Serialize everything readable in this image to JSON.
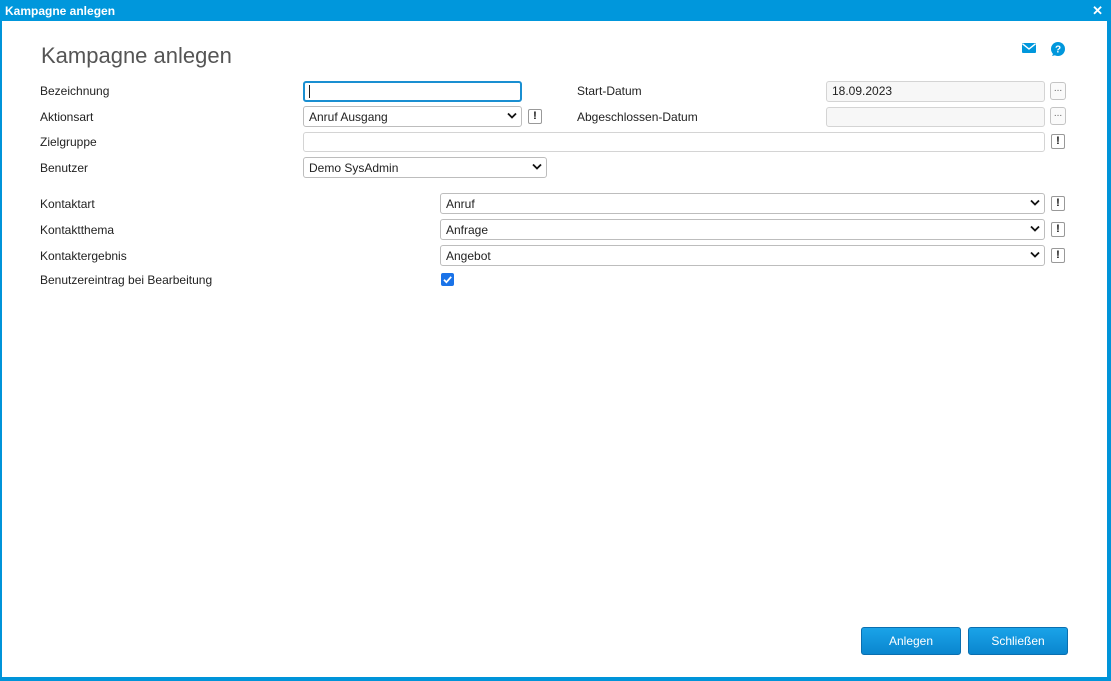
{
  "window": {
    "title": "Kampagne anlegen",
    "close_glyph": "✕"
  },
  "page": {
    "heading": "Kampagne anlegen"
  },
  "icons": {
    "mail": "mail-icon",
    "help": "help-icon",
    "accent": "#0097dc"
  },
  "form": {
    "bezeichnung_label": "Bezeichnung",
    "bezeichnung_value": "",
    "aktionsart_label": "Aktionsart",
    "aktionsart_value": "Anruf Ausgang",
    "zielgruppe_label": "Zielgruppe",
    "zielgruppe_value": "",
    "benutzer_label": "Benutzer",
    "benutzer_value": "Demo SysAdmin",
    "start_datum_label": "Start-Datum",
    "start_datum_value": "18.09.2023",
    "abgeschlossen_label": "Abgeschlossen-Datum",
    "abgeschlossen_value": "",
    "kontaktart_label": "Kontaktart",
    "kontaktart_value": "Anruf",
    "kontaktthema_label": "Kontaktthema",
    "kontaktthema_value": "Anfrage",
    "kontaktergebnis_label": "Kontaktergebnis",
    "kontaktergebnis_value": "Angebot",
    "benutzereintrag_label": "Benutzereintrag bei Bearbeitung",
    "benutzereintrag_checked": true,
    "exclaim_glyph": "!",
    "dots_glyph": "..."
  },
  "buttons": {
    "anlegen": "Anlegen",
    "schliessen": "Schließen"
  }
}
